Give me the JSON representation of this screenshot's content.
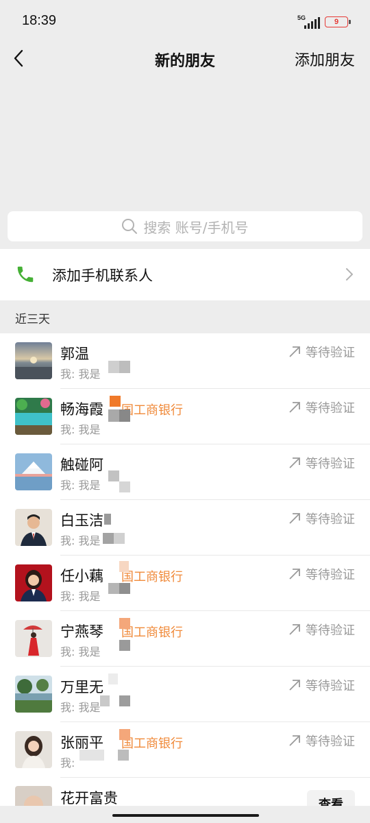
{
  "status_bar": {
    "time": "18:39",
    "network": "5G",
    "battery": "9"
  },
  "nav": {
    "title": "新的朋友",
    "action": "添加朋友"
  },
  "search": {
    "placeholder": "搜索 账号/手机号"
  },
  "phone_contacts": {
    "label": "添加手机联系人"
  },
  "section": {
    "title": "近三天"
  },
  "items": [
    {
      "name": "郭温",
      "org": "",
      "msg": "我: 我是",
      "status": "等待验证"
    },
    {
      "name": "畅海霞",
      "org": "国工商银行",
      "msg": "我: 我是",
      "status": "等待验证"
    },
    {
      "name": "触碰阿",
      "org": "",
      "msg": "我: 我是",
      "status": "等待验证"
    },
    {
      "name": "白玉洁",
      "org": "",
      "msg": "我: 我是",
      "status": "等待验证"
    },
    {
      "name": "任小藕",
      "org": "国工商银行",
      "msg": "我: 我是",
      "status": "等待验证"
    },
    {
      "name": "宁燕琴",
      "org": "国工商银行",
      "msg": "我: 我是",
      "status": "等待验证"
    },
    {
      "name": "万里无",
      "org": "",
      "msg": "我: 我是",
      "status": "等待验证"
    },
    {
      "name": "张丽平",
      "org": "国工商银行",
      "msg": "我:",
      "status": "等待验证"
    },
    {
      "name": "花开富贵",
      "org": "",
      "msg": "",
      "action": "查看"
    }
  ]
}
